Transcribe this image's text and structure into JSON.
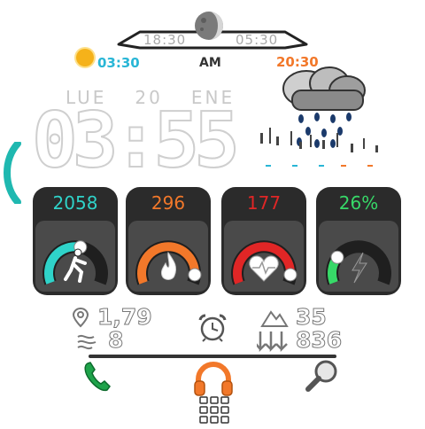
{
  "astro": {
    "moonrise": "18:30",
    "moonset": "05:30",
    "sunrise": "03:30",
    "ampm": "AM",
    "sunset": "20:30"
  },
  "date": {
    "weekday": "LUE",
    "day": "20",
    "month": "ENE"
  },
  "time": "03:55",
  "weather": {
    "icon": "rain-cloud-icon"
  },
  "cards": [
    {
      "value": "2058",
      "color": "#2fd3c9",
      "fraction": 0.55,
      "icon": "walking-person-icon"
    },
    {
      "value": "296",
      "color": "#f2782a",
      "fraction": 0.92,
      "icon": "flame-icon"
    },
    {
      "value": "177",
      "color": "#e02626",
      "fraction": 0.92,
      "icon": "heart-icon"
    },
    {
      "value": "26%",
      "color": "#37d968",
      "fraction": 0.26,
      "icon": "lightning-icon"
    }
  ],
  "stats": {
    "distance": "1,79",
    "wind": "8",
    "elevation": "35",
    "floors": "836"
  },
  "icons": {
    "phone": "phone-icon",
    "music": "headphones-icon",
    "search": "search-icon",
    "apps": "apps-grid-icon",
    "alarm": "alarm-clock-icon"
  }
}
